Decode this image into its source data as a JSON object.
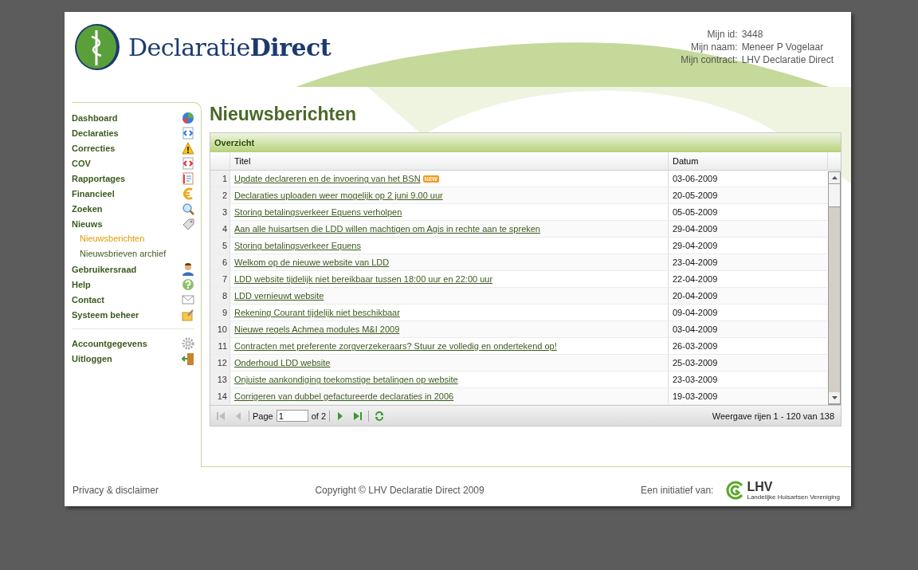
{
  "header": {
    "logo_text": "Declaratie**Direct**",
    "user_info": [
      {
        "label": "Mijn id:",
        "value": "3448"
      },
      {
        "label": "Mijn naam:",
        "value": "Meneer P Vogelaar"
      },
      {
        "label": "Mijn contract:",
        "value": "LHV Declaratie Direct"
      }
    ]
  },
  "sidebar": {
    "items": [
      {
        "label": "Dashboard",
        "selected": false
      },
      {
        "label": "Declaraties",
        "selected": false
      },
      {
        "label": "Correcties",
        "selected": false
      },
      {
        "label": "COV",
        "selected": false
      },
      {
        "label": "Rapportages",
        "selected": false
      },
      {
        "label": "Financieel",
        "selected": false
      },
      {
        "label": "Zoeken",
        "selected": false
      },
      {
        "label": "Nieuws",
        "selected": false,
        "children": [
          {
            "label": "Nieuwsberichten",
            "selected": true
          },
          {
            "label": "Nieuwsbrieven archief",
            "selected": false
          }
        ]
      },
      {
        "label": "Gebruikersraad",
        "selected": false
      },
      {
        "label": "Help",
        "selected": false
      },
      {
        "label": "Contact",
        "selected": false
      },
      {
        "label": "Systeem beheer",
        "selected": false
      }
    ],
    "bottom_items": [
      {
        "label": "Accountgegevens",
        "selected": false
      },
      {
        "label": "Uitloggen",
        "selected": false
      }
    ]
  },
  "page_title": "Nieuwsberichten",
  "grid": {
    "title": "Overzicht",
    "columns": [
      "Titel",
      "Datum"
    ],
    "rows": [
      {
        "number": "1",
        "title": "Update declareren en de invoering van het BSN",
        "badge": "NEW",
        "date": "03-06-2009"
      },
      {
        "number": "2",
        "title": "Declaraties uploaden weer mogelijk op 2 juni 9.00 uur",
        "date": "20-05-2009"
      },
      {
        "number": "3",
        "title": "Storing betalingsverkeer Equens verholpen",
        "date": "05-05-2009"
      },
      {
        "number": "4",
        "title": "Aan alle huisartsen die LDD willen machtigen om Agis in rechte aan te spreken",
        "date": "29-04-2009"
      },
      {
        "number": "5",
        "title": "Storing betalingsverkeer Equens",
        "date": "29-04-2009"
      },
      {
        "number": "6",
        "title": "Welkom op de nieuwe website van LDD",
        "date": "23-04-2009"
      },
      {
        "number": "7",
        "title": "LDD website tijdelijk niet bereikbaar tussen 18:00 uur en 22:00 uur",
        "date": "22-04-2009"
      },
      {
        "number": "8",
        "title": "LDD vernieuwt website",
        "date": "20-04-2009"
      },
      {
        "number": "9",
        "title": "Rekening Courant tijdelijk niet beschikbaar",
        "date": "09-04-2009"
      },
      {
        "number": "10",
        "title": "Nieuwe regels Achmea modules M&I 2009",
        "date": "03-04-2009"
      },
      {
        "number": "11",
        "title": "Contracten met preferente zorgverzekeraars? Stuur ze volledig en ondertekend op!",
        "date": "26-03-2009"
      },
      {
        "number": "12",
        "title": "Onderhoud LDD website",
        "date": "25-03-2009"
      },
      {
        "number": "13",
        "title": "Onjuiste aankondiging toekomstige betalingen op website",
        "date": "23-03-2009"
      },
      {
        "number": "14",
        "title": "Corrigeren van dubbel gefactureerde declaraties in 2006",
        "date": "19-03-2009"
      }
    ],
    "pager": {
      "page_label": "Page",
      "page_value": "1",
      "of_label": "of 2",
      "summary": "Weergave rijen 1 - 120 van 138"
    }
  },
  "footer": {
    "privacy": "Privacy & disclaimer",
    "copyright": "Copyright © LHV Declaratie Direct 2009",
    "initiative": "Een initiatief van:",
    "partner_logo": "LHV",
    "partner_subtitle": "Landelijke Huisartsen Vereniging"
  }
}
